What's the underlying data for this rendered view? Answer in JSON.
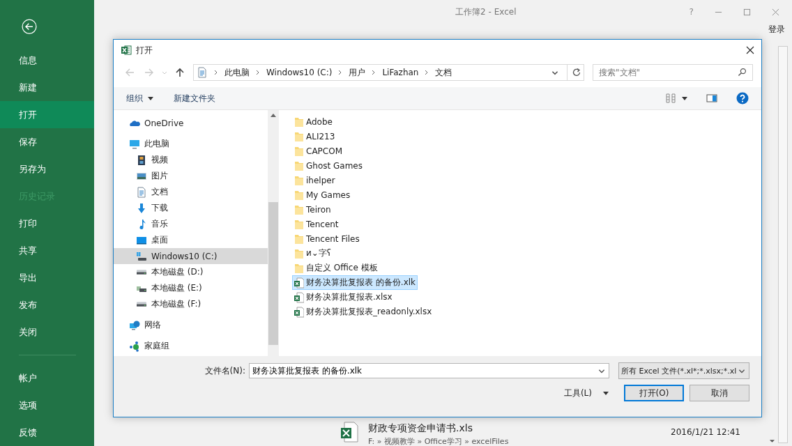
{
  "app": {
    "title": "工作簿2 - Excel",
    "help": "?",
    "login": "登录"
  },
  "sidebar": {
    "items": [
      {
        "label": "信息",
        "selected": false,
        "disabled": false
      },
      {
        "label": "新建",
        "selected": false,
        "disabled": false
      },
      {
        "label": "打开",
        "selected": true,
        "disabled": false
      },
      {
        "label": "保存",
        "selected": false,
        "disabled": false
      },
      {
        "label": "另存为",
        "selected": false,
        "disabled": false
      },
      {
        "label": "历史记录",
        "selected": false,
        "disabled": true
      },
      {
        "label": "打印",
        "selected": false,
        "disabled": false
      },
      {
        "label": "共享",
        "selected": false,
        "disabled": false
      },
      {
        "label": "导出",
        "selected": false,
        "disabled": false
      },
      {
        "label": "发布",
        "selected": false,
        "disabled": false
      },
      {
        "label": "关闭",
        "selected": false,
        "disabled": false
      }
    ],
    "bottom_items": [
      {
        "label": "帐户",
        "selected": false,
        "disabled": false
      },
      {
        "label": "选项",
        "selected": false,
        "disabled": false
      },
      {
        "label": "反馈",
        "selected": false,
        "disabled": false
      }
    ]
  },
  "recent_file": {
    "name": "财政专项资金申请书.xls",
    "path": "F: » 视频教学 » Office学习 » excelFiles",
    "date": "2016/1/21 12:41"
  },
  "dialog": {
    "title": "打开",
    "nav": {
      "back_disabled": true,
      "forward_disabled": true
    },
    "breadcrumb": [
      "此电脑",
      "Windows10 (C:)",
      "用户",
      "LiFazhan",
      "文档"
    ],
    "search": {
      "placeholder": "搜索\"文档\""
    },
    "toolbar": {
      "organize": "组织",
      "new_folder": "新建文件夹"
    },
    "nav_tree": [
      {
        "label": "OneDrive",
        "kind": "cloud",
        "selected": false
      },
      {
        "label": "此电脑",
        "kind": "computer",
        "selected": false,
        "children": [
          {
            "label": "视频",
            "kind": "video",
            "selected": false
          },
          {
            "label": "图片",
            "kind": "pictures",
            "selected": false
          },
          {
            "label": "文档",
            "kind": "document",
            "selected": false
          },
          {
            "label": "下载",
            "kind": "download",
            "selected": false
          },
          {
            "label": "音乐",
            "kind": "music",
            "selected": false
          },
          {
            "label": "桌面",
            "kind": "desktop",
            "selected": false
          },
          {
            "label": "Windows10 (C:)",
            "kind": "system-drive",
            "selected": true
          },
          {
            "label": "本地磁盘 (D:)",
            "kind": "drive",
            "selected": false
          },
          {
            "label": "本地磁盘 (E:)",
            "kind": "media-drive",
            "selected": false
          },
          {
            "label": "本地磁盘 (F:)",
            "kind": "drive",
            "selected": false
          }
        ]
      },
      {
        "label": "网络",
        "kind": "network",
        "selected": false
      },
      {
        "label": "家庭组",
        "kind": "homegroup",
        "selected": false
      }
    ],
    "files": [
      {
        "name": "Adobe",
        "kind": "folder",
        "selected": false
      },
      {
        "name": "ALI213",
        "kind": "folder",
        "selected": false
      },
      {
        "name": "CAPCOM",
        "kind": "folder",
        "selected": false
      },
      {
        "name": "Ghost Games",
        "kind": "folder",
        "selected": false
      },
      {
        "name": "ihelper",
        "kind": "folder",
        "selected": false
      },
      {
        "name": "My Games",
        "kind": "folder",
        "selected": false
      },
      {
        "name": "Teiron",
        "kind": "folder",
        "selected": false
      },
      {
        "name": "Tencent",
        "kind": "folder",
        "selected": false
      },
      {
        "name": "Tencent Files",
        "kind": "folder",
        "selected": false
      },
      {
        "name": "и⌄字ʕ",
        "kind": "folder",
        "selected": false
      },
      {
        "name": "自定义 Office 模板",
        "kind": "folder",
        "selected": false
      },
      {
        "name": "财务决算批复报表 的备份.xlk",
        "kind": "excel",
        "selected": true
      },
      {
        "name": "财务决算批复报表.xlsx",
        "kind": "excel",
        "selected": false
      },
      {
        "name": "财务决算批复报表_readonly.xlsx",
        "kind": "excel",
        "selected": false
      }
    ],
    "file_name": {
      "label": "文件名(N):",
      "value": "财务决算批复报表 的备份.xlk"
    },
    "file_type": "所有 Excel 文件(*.xl*;*.xlsx;*.xl",
    "tools": "工具(L)",
    "buttons": {
      "open": "打开(O)",
      "cancel": "取消"
    }
  }
}
